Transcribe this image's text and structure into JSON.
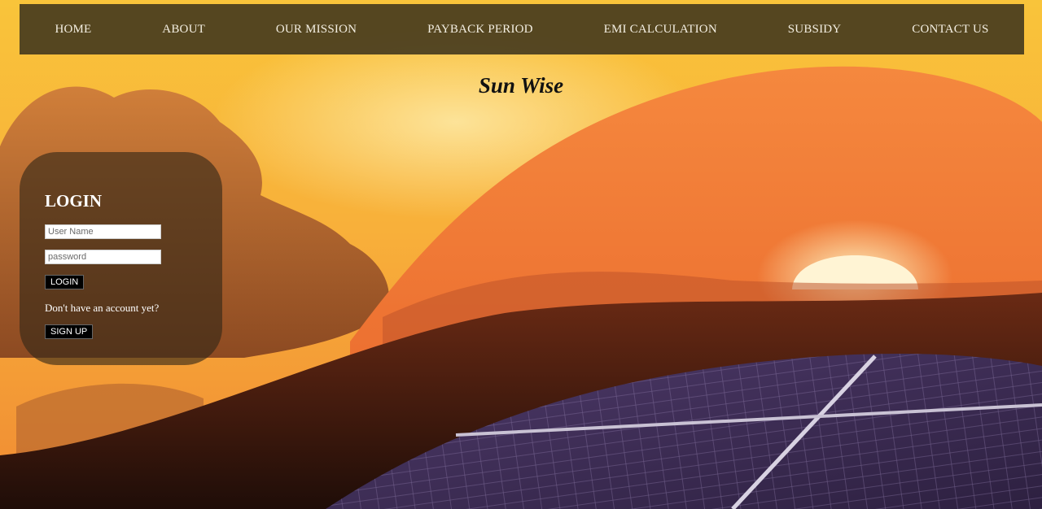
{
  "nav": {
    "items": [
      {
        "label": "HOME"
      },
      {
        "label": "ABOUT"
      },
      {
        "label": "OUR MISSION"
      },
      {
        "label": "PAYBACK PERIOD"
      },
      {
        "label": "EMI CALCULATION"
      },
      {
        "label": "SUBSIDY"
      },
      {
        "label": "CONTACT US"
      }
    ]
  },
  "site_title": "Sun Wise",
  "login": {
    "title": "LOGIN",
    "username_placeholder": "User Name",
    "password_placeholder": "password",
    "login_button": "LOGIN",
    "no_account_text": "Don't have an account yet?",
    "signup_button": "SIGN UP"
  },
  "colors": {
    "sky_top": "#f7b52c",
    "sky_bottom": "#f28a2e",
    "swoosh": "#f07a3a",
    "sun": "#fff6d8",
    "hills": "#3a1a10",
    "panel": "#3c2a55",
    "nav_bg": "#3e341c"
  }
}
